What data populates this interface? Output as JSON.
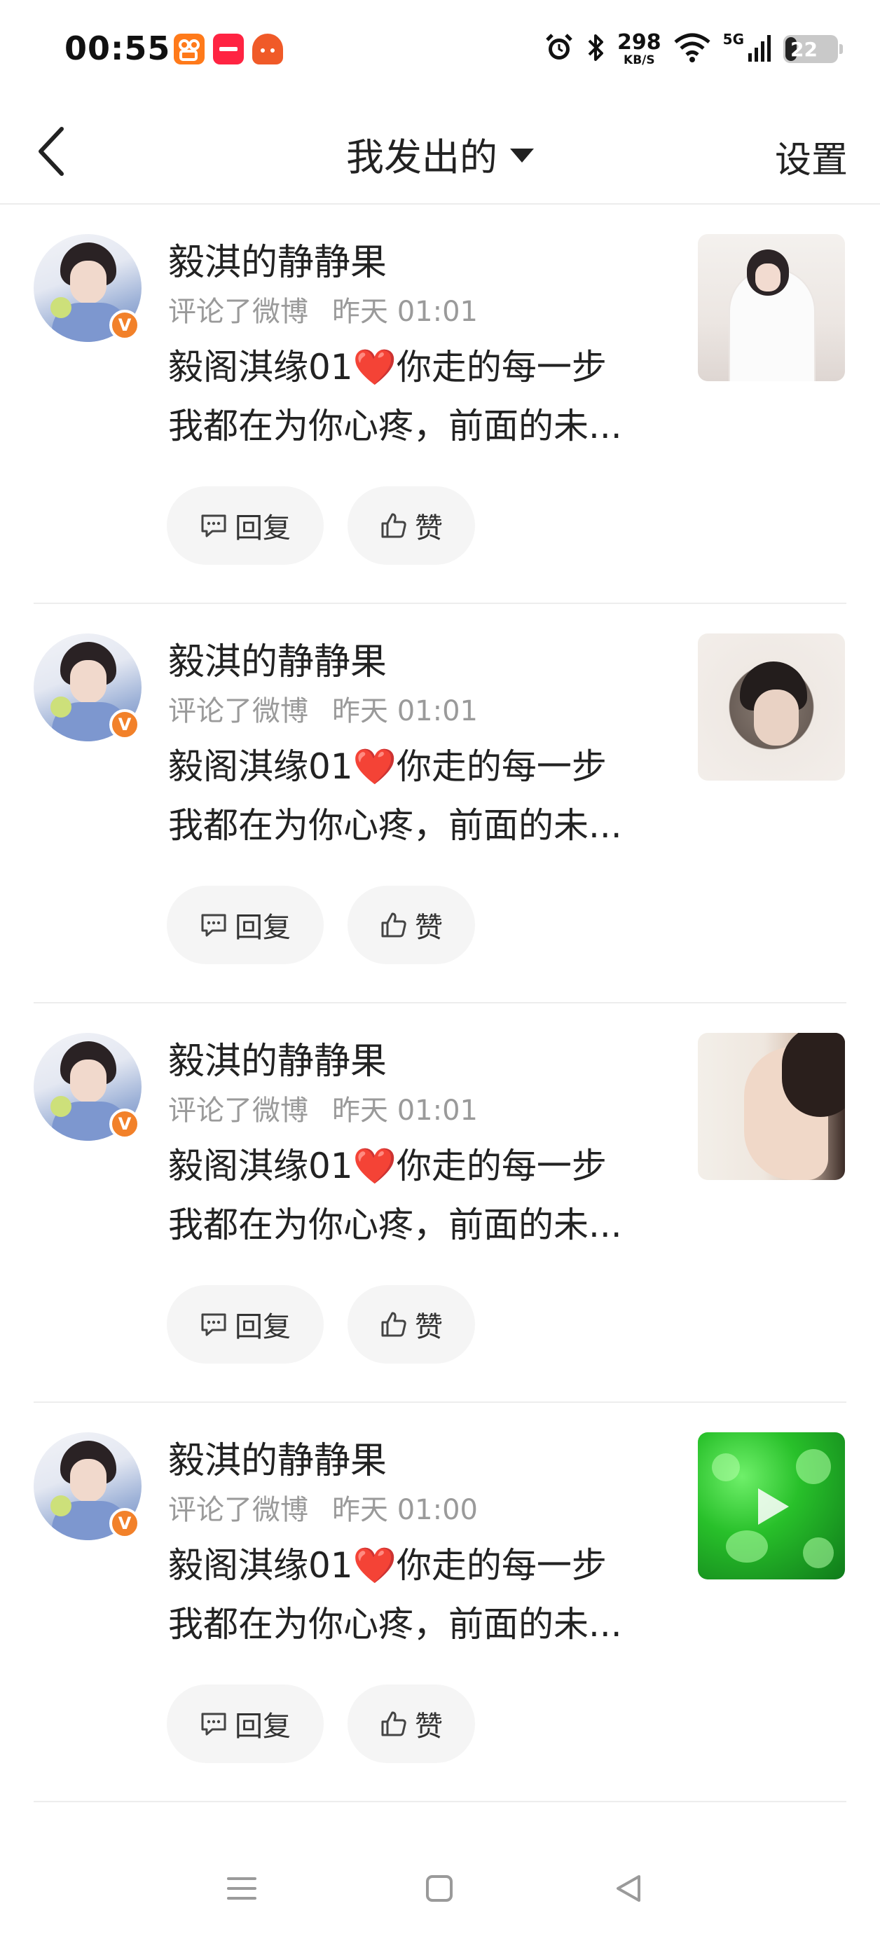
{
  "status_bar": {
    "time": "00:55",
    "net_speed": "298",
    "net_unit": "KB/S",
    "network": "5G",
    "battery": "22",
    "battery_level": 0.22,
    "app_icons": [
      "kuaishou-icon",
      "xiaohongshu-icon",
      "app-icon"
    ],
    "app_icon_colors": [
      "#ff7a1a",
      "#ff2442",
      "#f05a28"
    ],
    "indicator_icons": [
      "alarm-icon",
      "bluetooth-icon",
      "wifi-icon",
      "signal-icon",
      "battery-icon"
    ]
  },
  "header": {
    "back_icon": "chevron-left-icon",
    "title": "我发出的",
    "dropdown_icon": "caret-down-icon",
    "settings": "设置"
  },
  "accent_color": "#f2812a",
  "items": [
    {
      "username": "毅淇的静静果",
      "action": "评论了微博",
      "time": "昨天 01:01",
      "line1_pre": "毅阁淇缘01",
      "heart": "❤️",
      "line1_post": "你走的每一步",
      "line2": "我都在为你心疼，前面的未...",
      "reply": "回复",
      "like": "赞",
      "verified_badge": "V",
      "thumbnail": "photo"
    },
    {
      "username": "毅淇的静静果",
      "action": "评论了微博",
      "time": "昨天 01:01",
      "line1_pre": "毅阁淇缘01",
      "heart": "❤️",
      "line1_post": "你走的每一步",
      "line2": "我都在为你心疼，前面的未...",
      "reply": "回复",
      "like": "赞",
      "verified_badge": "V",
      "thumbnail": "photo"
    },
    {
      "username": "毅淇的静静果",
      "action": "评论了微博",
      "time": "昨天 01:01",
      "line1_pre": "毅阁淇缘01",
      "heart": "❤️",
      "line1_post": "你走的每一步",
      "line2": "我都在为你心疼，前面的未...",
      "reply": "回复",
      "like": "赞",
      "verified_badge": "V",
      "thumbnail": "photo"
    },
    {
      "username": "毅淇的静静果",
      "action": "评论了微博",
      "time": "昨天 01:00",
      "line1_pre": "毅阁淇缘01",
      "heart": "❤️",
      "line1_post": "你走的每一步",
      "line2": "我都在为你心疼，前面的未...",
      "reply": "回复",
      "like": "赞",
      "verified_badge": "V",
      "thumbnail": "video"
    }
  ],
  "system_nav": [
    "menu-icon",
    "home-icon",
    "back-icon"
  ]
}
